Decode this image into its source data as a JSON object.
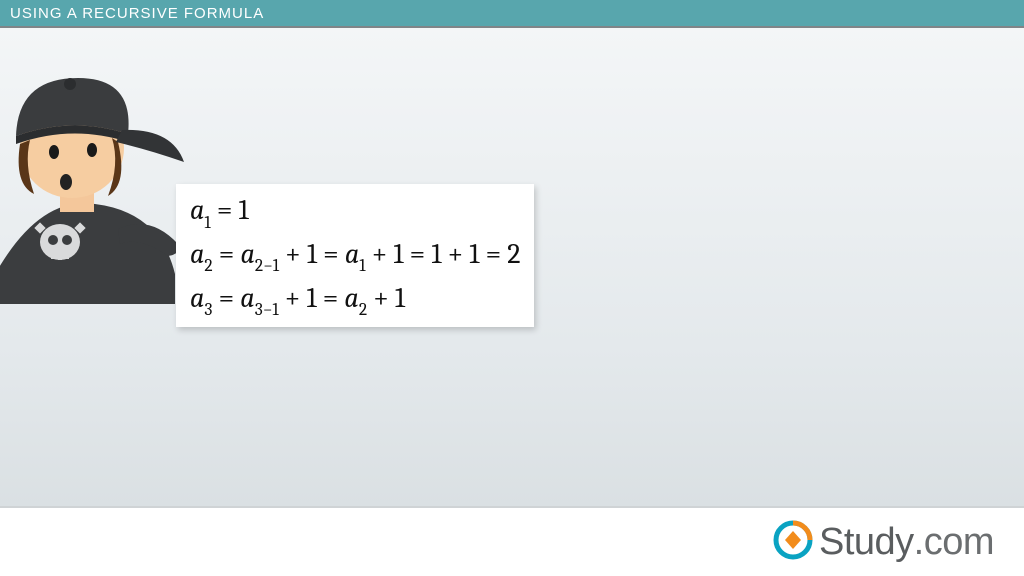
{
  "title": "USING A RECURSIVE FORMULA",
  "formula": {
    "line1_html": "<i>a</i><sub>1</sub> = 1",
    "line2_html": "<i>a</i><sub>2</sub> = <i>a</i><sub>2−1</sub> + 1 = <i>a</i><sub>1</sub> + 1 = 1 + 1 = 2",
    "line3_html": "<i>a</i><sub>3</sub> = <i>a</i><sub>3−1</sub> + 1 = <i>a</i><sub>2</sub> + 1"
  },
  "brand": {
    "name_strong": "Study",
    "name_light": ".com"
  }
}
